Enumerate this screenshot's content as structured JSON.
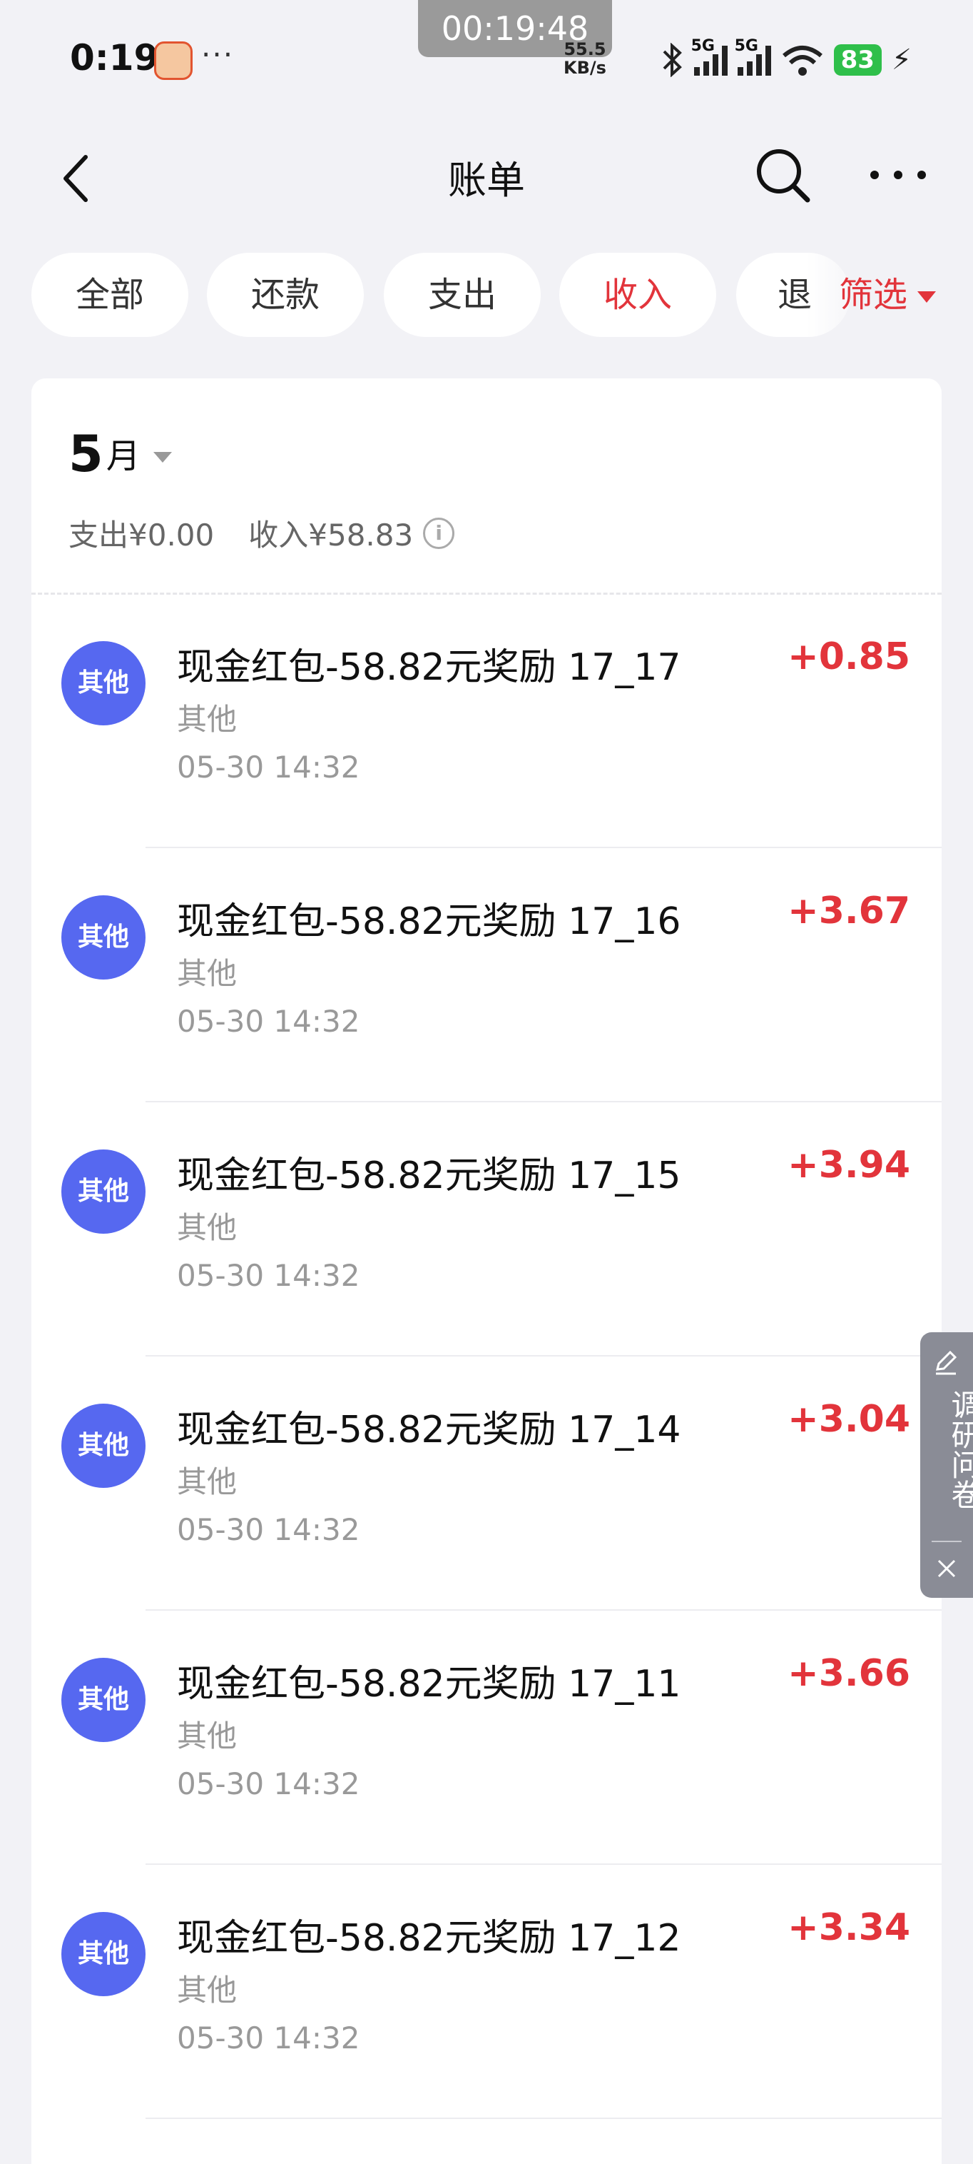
{
  "status_bar": {
    "time": "0:19",
    "recording_timer": "00:19:48",
    "net_speed_value": "55.5",
    "net_speed_unit": "KB/s",
    "signal_1_label": "5G",
    "signal_2_label": "5G",
    "battery": "83",
    "icons": [
      "app-notification-icon",
      "more-notifications-icon",
      "bluetooth-icon",
      "signal-icon",
      "wifi-icon",
      "battery-icon",
      "charging-icon"
    ]
  },
  "header": {
    "title": "账单"
  },
  "filters": {
    "tabs": [
      {
        "label": "全部",
        "active": false
      },
      {
        "label": "还款",
        "active": false
      },
      {
        "label": "支出",
        "active": false
      },
      {
        "label": "收入",
        "active": true
      },
      {
        "label": "退",
        "active": false
      }
    ],
    "filter_label": "筛选"
  },
  "month": {
    "number": "5",
    "unit": "月",
    "expense_summary": "支出¥0.00",
    "income_summary": "收入¥58.83"
  },
  "transactions": [
    {
      "avatar": "其他",
      "title": "现金红包-58.82元奖励 17_17",
      "category": "其他",
      "time": "05-30 14:32",
      "amount": "+0.85"
    },
    {
      "avatar": "其他",
      "title": "现金红包-58.82元奖励 17_16",
      "category": "其他",
      "time": "05-30 14:32",
      "amount": "+3.67"
    },
    {
      "avatar": "其他",
      "title": "现金红包-58.82元奖励 17_15",
      "category": "其他",
      "time": "05-30 14:32",
      "amount": "+3.94"
    },
    {
      "avatar": "其他",
      "title": "现金红包-58.82元奖励 17_14",
      "category": "其他",
      "time": "05-30 14:32",
      "amount": "+3.04"
    },
    {
      "avatar": "其他",
      "title": "现金红包-58.82元奖励 17_11",
      "category": "其他",
      "time": "05-30 14:32",
      "amount": "+3.66"
    },
    {
      "avatar": "其他",
      "title": "现金红包-58.82元奖励 17_12",
      "category": "其他",
      "time": "05-30 14:32",
      "amount": "+3.34"
    }
  ],
  "survey": {
    "label": "调研问卷"
  },
  "colors": {
    "accent_red": "#e2343b",
    "avatar_blue": "#5668f0",
    "page_bg": "#f2f2f6"
  }
}
